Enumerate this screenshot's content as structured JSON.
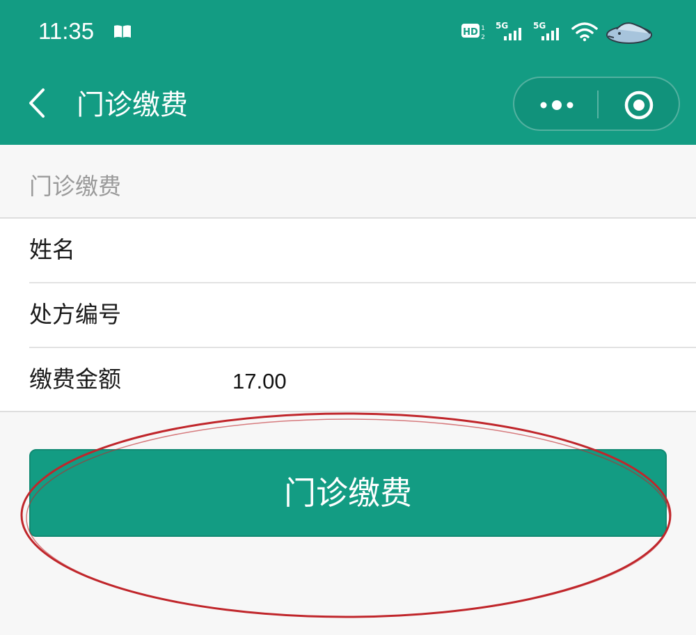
{
  "status_bar": {
    "time": "11:35",
    "icons": [
      "book-icon",
      "hd-icon",
      "signal-5g-icon",
      "signal-5g-icon",
      "wifi-icon",
      "seal-icon"
    ],
    "hd_label": "HD",
    "signal_label": "5G"
  },
  "nav": {
    "title": "门诊缴费",
    "back_icon": "chevron-left-icon",
    "more_icon": "more-dots-icon",
    "close_icon": "target-close-icon"
  },
  "section": {
    "title": "门诊缴费"
  },
  "form": {
    "rows": [
      {
        "label": "姓名",
        "value": ""
      },
      {
        "label": "处方编号",
        "value": ""
      },
      {
        "label": "缴费金额",
        "value": "17.00"
      }
    ]
  },
  "submit": {
    "label": "门诊缴费"
  },
  "colors": {
    "primary": "#139c83",
    "background": "#f7f7f7",
    "annotation": "#c0262b"
  }
}
